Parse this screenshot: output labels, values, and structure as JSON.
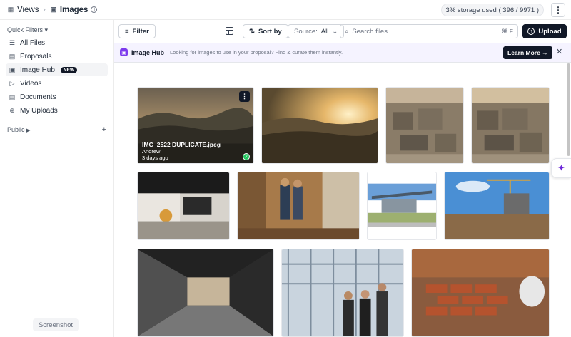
{
  "header": {
    "crumb_root": "Views",
    "crumb_current": "Images",
    "storage": "3% storage used ( 396 / 9971 )"
  },
  "sidebar": {
    "quick_filters_label": "Quick Filters",
    "items": [
      {
        "label": "All Files",
        "icon": "stack-icon"
      },
      {
        "label": "Proposals",
        "icon": "document-icon"
      },
      {
        "label": "Image Hub",
        "icon": "image-icon",
        "badge": "NEW",
        "active": true
      },
      {
        "label": "Videos",
        "icon": "play-icon"
      },
      {
        "label": "Documents",
        "icon": "file-icon"
      },
      {
        "label": "My Uploads",
        "icon": "upload-icon"
      }
    ],
    "public_label": "Public",
    "screenshot_label": "Screenshot"
  },
  "toolbar": {
    "filter_label": "Filter",
    "sort_label": "Sort by",
    "source_prefix": "Source:",
    "source_value": "All",
    "search_placeholder": "Search files...",
    "search_shortcut": "⌘ F",
    "upload_label": "Upload"
  },
  "banner": {
    "title": "Image Hub",
    "text": "Looking for images to use in your proposal? Find & curate them instantly.",
    "cta": "Learn More →"
  },
  "gallery": {
    "featured": {
      "filename": "IMG_2522 DUPLICATE.jpeg",
      "author": "Andrew",
      "date": "3 days ago"
    },
    "tiles": [
      {
        "subject": "mountain sunset"
      },
      {
        "subject": "mountain sunset warm"
      },
      {
        "subject": "construction site aerial"
      },
      {
        "subject": "construction site aerial"
      },
      {
        "subject": "office desk"
      },
      {
        "subject": "workers in building"
      },
      {
        "subject": "modern building canopy"
      },
      {
        "subject": "construction crane site"
      },
      {
        "subject": "office hallway"
      },
      {
        "subject": "business people glass building"
      },
      {
        "subject": "bricklaying"
      }
    ]
  },
  "colors": {
    "accent": "#111827",
    "brand_purple": "#7c3aed",
    "banner_bg": "#f5f3ff",
    "success": "#22c55e"
  }
}
